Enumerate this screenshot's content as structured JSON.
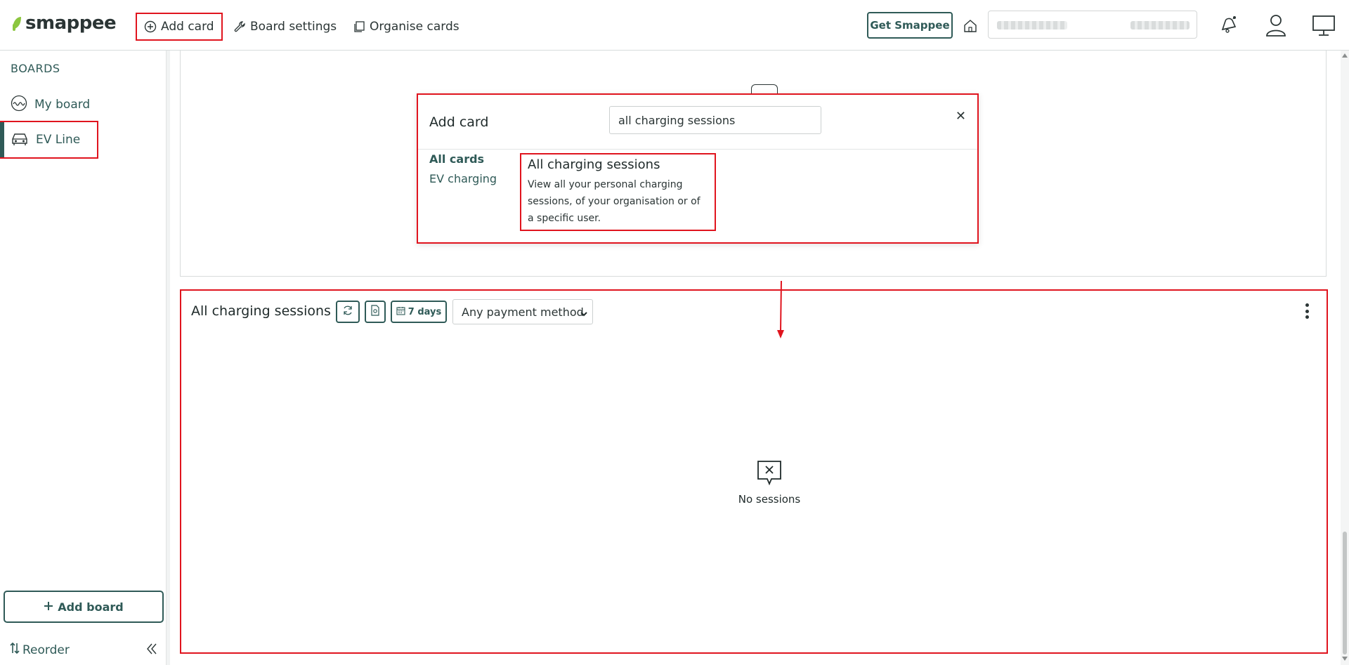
{
  "brand": {
    "name": "smappee",
    "logo_color": "#8cc63f"
  },
  "colors": {
    "accent": "#2f5a57",
    "highlight": "#e0141e"
  },
  "toolbar": {
    "add_card": "Add card",
    "board_settings": "Board settings",
    "organise_cards": "Organise cards",
    "get_smappee": "Get Smappee"
  },
  "sidebar": {
    "title": "BOARDS",
    "items": [
      {
        "label": "My board",
        "icon": "waveform-icon"
      },
      {
        "label": "EV Line",
        "icon": "car-icon",
        "active": true
      }
    ],
    "add_board": "Add board",
    "reorder": "Reorder"
  },
  "add_card_dialog": {
    "title": "Add card",
    "search_value": "all charging sessions",
    "categories": [
      "All cards",
      "EV charging"
    ],
    "result": {
      "title": "All charging sessions",
      "description": "View all your personal charging sessions, of your organisation or of a specific user."
    }
  },
  "sessions_card": {
    "title": "All charging sessions",
    "period_label": "7 days",
    "payment_filter": "Any payment method",
    "empty_text": "No sessions"
  }
}
